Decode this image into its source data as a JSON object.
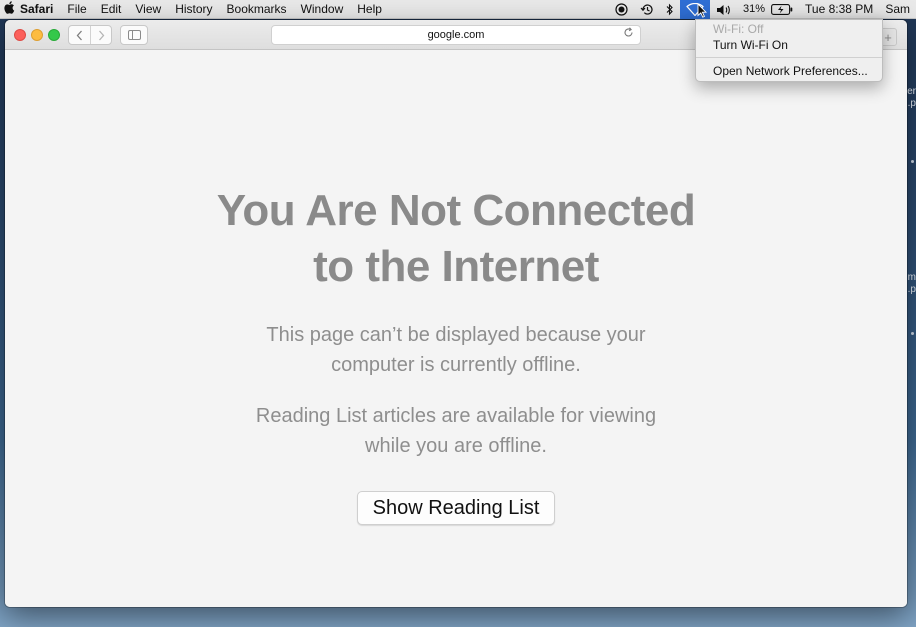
{
  "menubar": {
    "apple_icon": "apple-logo-icon",
    "app_name": "Safari",
    "menus": [
      "File",
      "Edit",
      "View",
      "History",
      "Bookmarks",
      "Window",
      "Help"
    ],
    "status": {
      "battery": "31%",
      "clock": "Tue 8:38 PM",
      "user": "Sam"
    }
  },
  "browser": {
    "address": "google.com"
  },
  "page": {
    "headline_line1": "You Are Not Connected",
    "headline_line2": "to the Internet",
    "message1_line1": "This page can’t be displayed because your",
    "message1_line2": "computer is currently offline.",
    "message2_line1": "Reading List articles are available for viewing",
    "message2_line2": "while you are offline.",
    "button_label": "Show Reading List"
  },
  "wifi_menu": {
    "status": "Wi-Fi: Off",
    "toggle": "Turn Wi-Fi On",
    "preferences": "Open Network Preferences..."
  },
  "colors": {
    "close": "#fc605b",
    "minimize": "#fdbc40",
    "maximize": "#34c84a",
    "menu_highlight": "#2f6fd6"
  }
}
